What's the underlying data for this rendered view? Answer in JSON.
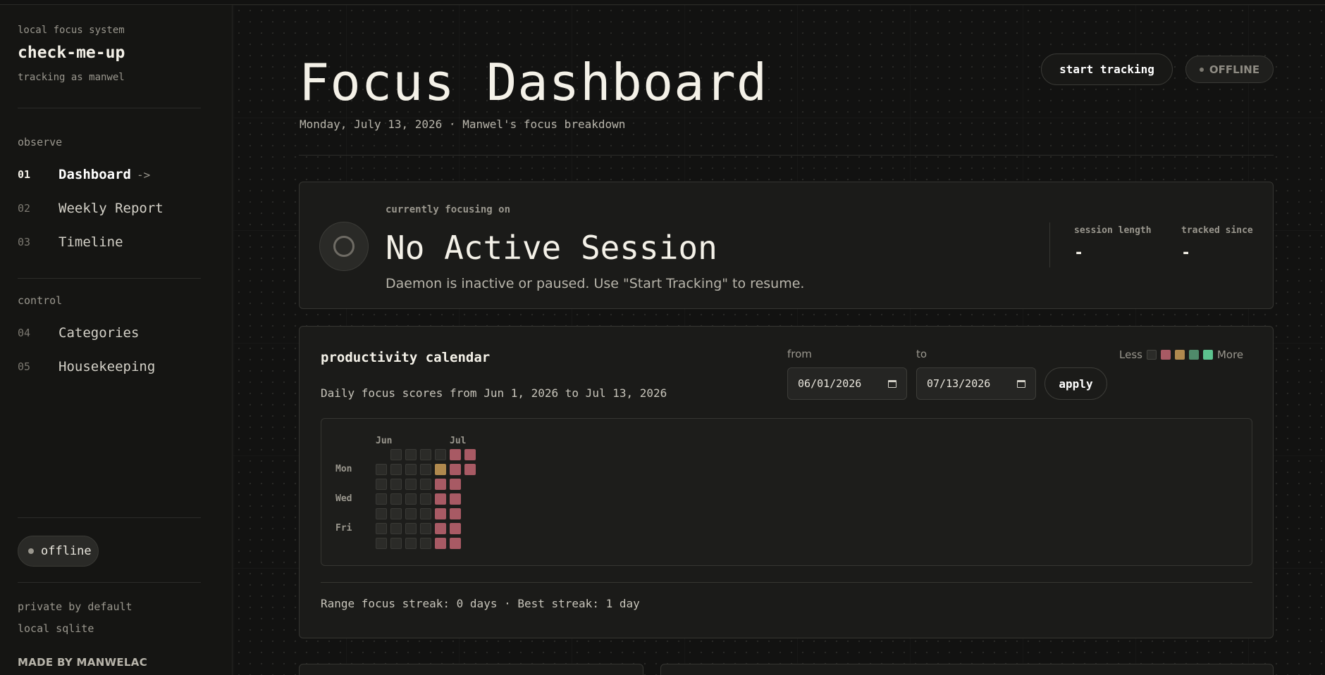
{
  "sidebar": {
    "kicker": "local focus system",
    "brand": "check-me-up",
    "user": "tracking as manwel",
    "sections": [
      {
        "label": "observe",
        "items": [
          {
            "num": "01",
            "label": "Dashboard",
            "arrow": "->",
            "active": true
          },
          {
            "num": "02",
            "label": "Weekly Report"
          },
          {
            "num": "03",
            "label": "Timeline"
          }
        ]
      },
      {
        "label": "control",
        "items": [
          {
            "num": "04",
            "label": "Categories"
          },
          {
            "num": "05",
            "label": "Housekeeping"
          }
        ]
      }
    ],
    "status_pill": "offline",
    "footer": [
      "private by default",
      "local sqlite"
    ],
    "made_by": "MADE BY MANWELAC"
  },
  "header": {
    "title": "Focus Dashboard",
    "subtitle": "Monday, July 13, 2026 · Manwel's focus breakdown",
    "start_button": "start tracking",
    "status_badge": "OFFLINE"
  },
  "session": {
    "kicker": "currently focusing on",
    "title": "No Active Session",
    "description": "Daemon is inactive or paused. Use \"Start Tracking\" to resume.",
    "stats": [
      {
        "label": "session length",
        "value": "-"
      },
      {
        "label": "tracked since",
        "value": "-"
      }
    ]
  },
  "calendar": {
    "title": "productivity calendar",
    "description": "Daily focus scores from Jun 1, 2026 to Jul 13, 2026",
    "from_label": "from",
    "from_value": "06/01/2026",
    "to_label": "to",
    "to_value": "07/13/2026",
    "apply_label": "apply",
    "legend_less": "Less",
    "legend_more": "More",
    "legend_colors": [
      "#2b2b28",
      "#a85a64",
      "#b0894e",
      "#4f8a6a",
      "#5cc38e"
    ],
    "months": [
      {
        "label": "Jun",
        "col": 0
      },
      {
        "label": "Jul",
        "col": 5
      }
    ],
    "day_labels": [
      {
        "label": "Mon",
        "row": 1
      },
      {
        "label": "Wed",
        "row": 3
      },
      {
        "label": "Fri",
        "row": 5
      }
    ],
    "weeks": [
      [
        null,
        0,
        0,
        0,
        0,
        0,
        0
      ],
      [
        0,
        0,
        0,
        0,
        0,
        0,
        0
      ],
      [
        0,
        0,
        0,
        0,
        0,
        0,
        0
      ],
      [
        0,
        0,
        0,
        0,
        0,
        0,
        0
      ],
      [
        0,
        2,
        1,
        1,
        1,
        1,
        1
      ],
      [
        1,
        1,
        1,
        1,
        1,
        1,
        1
      ],
      [
        1,
        1,
        null,
        null,
        null,
        null,
        null
      ]
    ],
    "streak_text": "Range focus streak: 0 days · Best streak: 1 day"
  }
}
